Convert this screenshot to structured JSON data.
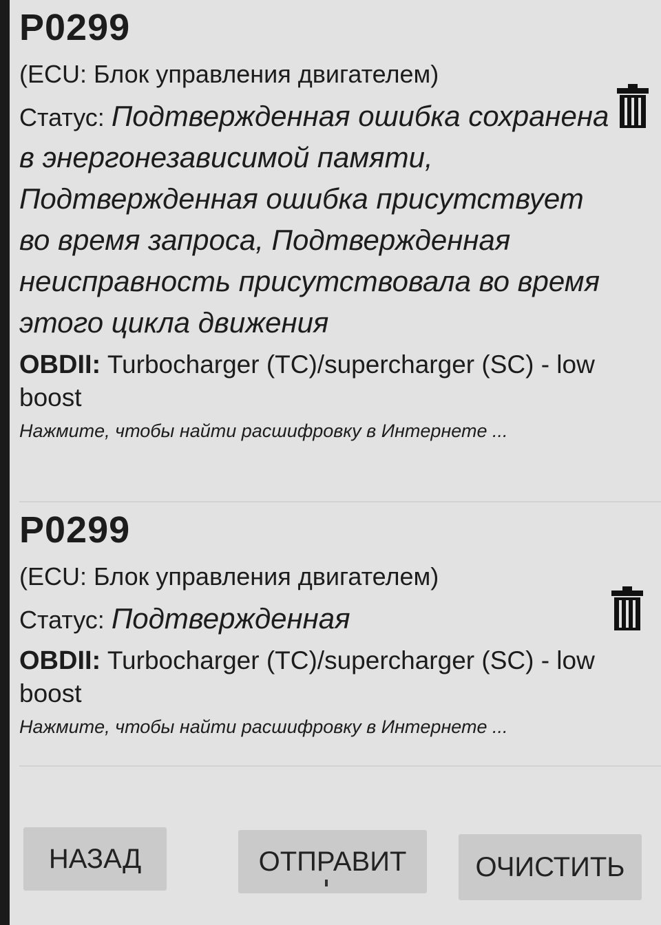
{
  "dtcs": [
    {
      "code": "P0299",
      "ecu": "(ECU: Блок управления двигателем)",
      "status_label": "Статус: ",
      "status_value": "Подтвержденная ошибка сохранена в энергонезависимой памяти, Подтвержденная ошибка присутствует во время запроса, Подтвержденная неисправность присутствовала во время этого цикла движения",
      "obd_label": "OBDII:",
      "obd_text": " Turbocharger (TC)/supercharger (SC) - low boost",
      "hint": "Нажмите, чтобы найти расшифровку в Интернете ..."
    },
    {
      "code": "P0299",
      "ecu": "(ECU: Блок управления двигателем)",
      "status_label": "Статус: ",
      "status_value": "Подтвержденная",
      "obd_label": "OBDII:",
      "obd_text": " Turbocharger (TC)/supercharger (SC) - low boost",
      "hint": "Нажмите, чтобы найти расшифровку в Интернете ..."
    }
  ],
  "buttons": {
    "back": "НАЗАД",
    "send": "ОТПРАВИТ",
    "clear": "ОЧИСТИТЬ"
  },
  "icons": {
    "delete": "trash-icon"
  }
}
